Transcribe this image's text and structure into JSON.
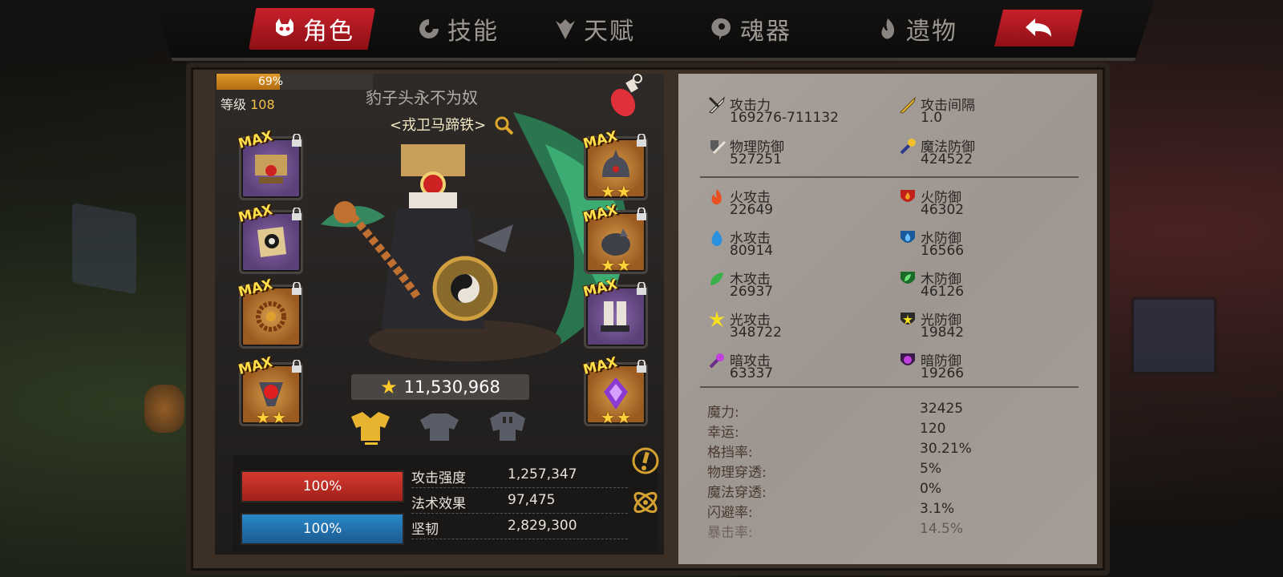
{
  "tabs": [
    {
      "label": "角色",
      "active": true,
      "icon": "demon-mask-icon"
    },
    {
      "label": "技能",
      "active": false,
      "icon": "swirl-skill-icon"
    },
    {
      "label": "天赋",
      "active": false,
      "icon": "talent-crest-icon"
    },
    {
      "label": "魂器",
      "active": false,
      "icon": "soul-vessel-icon"
    },
    {
      "label": "遗物",
      "active": false,
      "icon": "relic-flame-icon"
    }
  ],
  "back_button": {
    "icon": "back-arrow-icon"
  },
  "hero": {
    "xp_percent": 69,
    "xp_label": "69%",
    "level_label": "等级",
    "level_value": "108",
    "title": "豹子头永不为奴",
    "name": "<戎卫马蹄铁>",
    "power_value": "11,530,968"
  },
  "equipment_left": [
    {
      "icon": "bagua-hat-icon",
      "tag": "MAX",
      "rarity": "purple",
      "stars": 0
    },
    {
      "icon": "yinyang-charm-icon",
      "tag": "MAX",
      "rarity": "purple",
      "stars": 0
    },
    {
      "icon": "prayer-beads-icon",
      "tag": "MAX",
      "rarity": "orange",
      "stars": 0
    },
    {
      "icon": "red-orb-amulet-icon",
      "tag": "MAX",
      "rarity": "orange",
      "stars": 2
    }
  ],
  "equipment_right": [
    {
      "icon": "spiked-helmet-icon",
      "tag": "MAX",
      "rarity": "orange",
      "stars": 2
    },
    {
      "icon": "spiked-pauldron-icon",
      "tag": "MAX",
      "rarity": "orange",
      "stars": 2
    },
    {
      "icon": "armored-boots-icon",
      "tag": "MAX",
      "rarity": "purple",
      "stars": 0
    },
    {
      "icon": "purple-gem-amulet-icon",
      "tag": "MAX",
      "rarity": "orange",
      "stars": 2
    }
  ],
  "armor_tabs": [
    {
      "icon": "armor-set-1-icon",
      "active": true
    },
    {
      "icon": "armor-set-2-icon",
      "active": false
    },
    {
      "icon": "armor-set-3-icon",
      "active": false
    }
  ],
  "bars": {
    "hp_label": "100%",
    "hp_percent": 100,
    "mp_label": "100%",
    "mp_percent": 100
  },
  "summary_stats": [
    {
      "label": "攻击强度",
      "value": "1,257,347"
    },
    {
      "label": "法术效果",
      "value": "97,475"
    },
    {
      "label": "坚韧",
      "value": "2,829,300"
    }
  ],
  "side_icons": [
    "alert-badge-icon",
    "atom-orbit-icon"
  ],
  "attributes_primary": [
    {
      "label": "攻击力",
      "value": "169276-711132",
      "icon": "sword-attack-icon"
    },
    {
      "label": "攻击间隔",
      "value": "1.0",
      "icon": "gold-sword-icon"
    },
    {
      "label": "物理防御",
      "value": "527251",
      "icon": "shield-sword-icon"
    },
    {
      "label": "魔法防御",
      "value": "424522",
      "icon": "magic-wand-icon"
    }
  ],
  "attributes_elemental": [
    {
      "label": "火攻击",
      "value": "22649",
      "icon": "fire-attack-icon"
    },
    {
      "label": "火防御",
      "value": "46302",
      "icon": "fire-defense-icon"
    },
    {
      "label": "水攻击",
      "value": "80914",
      "icon": "water-attack-icon"
    },
    {
      "label": "水防御",
      "value": "16566",
      "icon": "water-defense-icon"
    },
    {
      "label": "木攻击",
      "value": "26937",
      "icon": "wood-attack-icon"
    },
    {
      "label": "木防御",
      "value": "46126",
      "icon": "wood-defense-icon"
    },
    {
      "label": "光攻击",
      "value": "348722",
      "icon": "light-attack-icon"
    },
    {
      "label": "光防御",
      "value": "19842",
      "icon": "light-defense-icon"
    },
    {
      "label": "暗攻击",
      "value": "63337",
      "icon": "dark-attack-icon"
    },
    {
      "label": "暗防御",
      "value": "19266",
      "icon": "dark-defense-icon"
    }
  ],
  "attributes_other": [
    {
      "label": "魔力:",
      "value": "32425"
    },
    {
      "label": "幸运:",
      "value": "120"
    },
    {
      "label": "格挡率:",
      "value": "30.21%"
    },
    {
      "label": "物理穿透:",
      "value": "5%"
    },
    {
      "label": "魔法穿透:",
      "value": "0%"
    },
    {
      "label": "闪避率:",
      "value": "3.1%"
    },
    {
      "label": "暴击率:",
      "value": "14.5%"
    }
  ],
  "colors": {
    "active_tab": "#c8202a",
    "gold": "#f3c04a",
    "hp": "#d63a30",
    "mp": "#2a88c8"
  }
}
